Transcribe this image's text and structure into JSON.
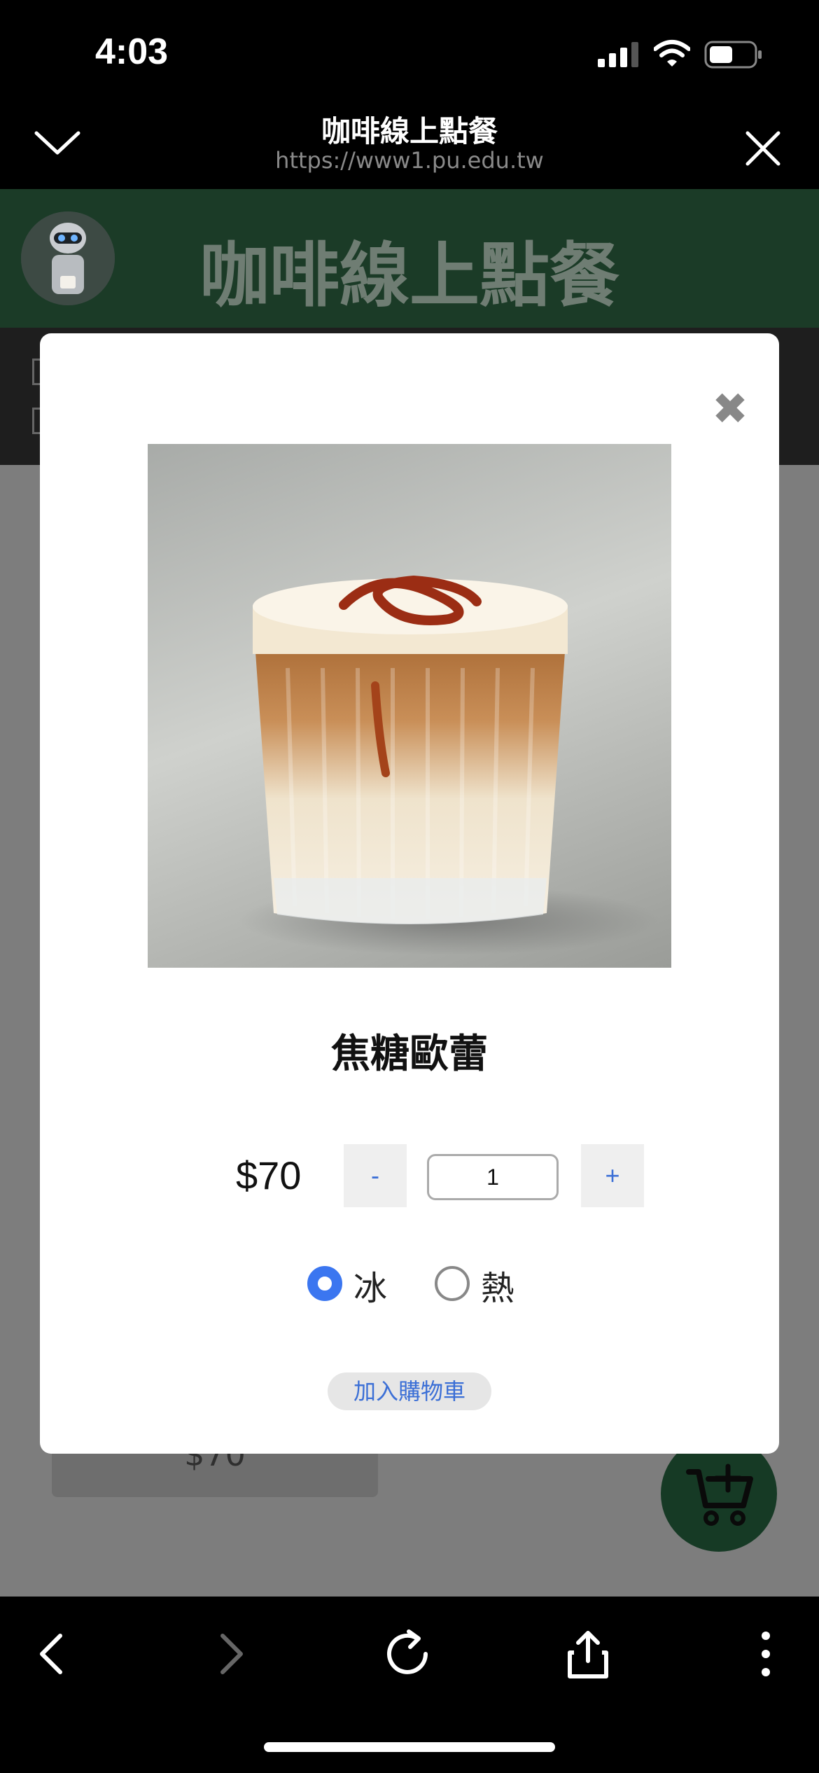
{
  "status_bar": {
    "time": "4:03",
    "icons": [
      "cellular-signal-icon",
      "wifi-icon",
      "battery-icon"
    ]
  },
  "browser": {
    "title": "咖啡線上點餐",
    "url": "https://www1.pu.edu.tw",
    "icons": {
      "top_left": "chevron-down-icon",
      "top_right": "close-icon",
      "bottom": [
        "back-icon",
        "forward-icon",
        "reload-icon",
        "share-icon",
        "more-icon"
      ]
    }
  },
  "site": {
    "header_title": "咖啡線上點餐",
    "background_card_price": "$70"
  },
  "modal": {
    "close_symbol": "✖",
    "product_name": "焦糖歐蕾",
    "price": "$70",
    "minus_label": "-",
    "plus_label": "+",
    "quantity": "1",
    "temperature_options": [
      {
        "label": "冰",
        "selected": true
      },
      {
        "label": "熱",
        "selected": false
      }
    ],
    "add_to_cart_label": "加入購物車"
  },
  "colors": {
    "header_green": "#1b3b27",
    "accent_blue": "#3b76f0",
    "link_blue": "#3b6fd6",
    "overlay_gray": "#7d7d7d"
  }
}
